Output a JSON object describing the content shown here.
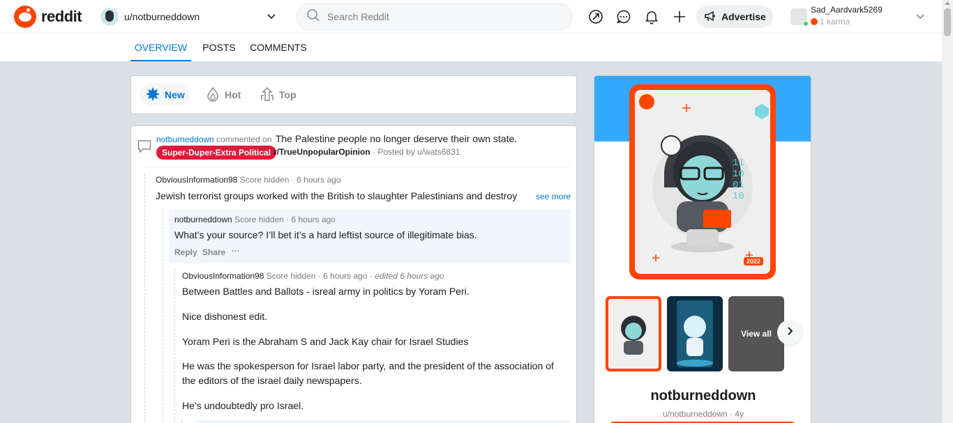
{
  "header": {
    "logo_text": "reddit",
    "context_label": "u/notburneddown",
    "search_placeholder": "Search Reddit",
    "advertise_label": "Advertise",
    "user_name": "Sad_Aardvark5269",
    "user_karma": "1 karma"
  },
  "tabs": [
    {
      "label": "OVERVIEW",
      "active": true
    },
    {
      "label": "POSTS",
      "active": false
    },
    {
      "label": "COMMENTS",
      "active": false
    }
  ],
  "sort": {
    "new_label": "New",
    "hot_label": "Hot",
    "top_label": "Top"
  },
  "post": {
    "author": "notburneddown",
    "action_text": "commented on",
    "title": "The Palestine people no longer deserve their own state.",
    "flair": "Super-Duper-Extra Political",
    "subreddit": "r/TrueUnpopularOpinion",
    "posted_by": "· Posted by u/wats6831"
  },
  "comments": [
    {
      "author": "ObviousInformation98",
      "meta": "Score hidden · 6 hours ago",
      "body": "Jewish terrorist groups worked with the British to slaughter Palestinians and destroy",
      "see_more": "see more"
    },
    {
      "author": "notburneddown",
      "meta": "Score hidden · 6 hours ago",
      "body": "What’s your source? I’ll bet it’s a hard leftist source of illegitimate bias.",
      "reply": "Reply",
      "share": "Share",
      "more": "···"
    },
    {
      "author": "ObviousInformation98",
      "meta": "Score hidden · 6 hours ago ·",
      "edited": "edited 6 hours ago",
      "paragraphs": [
        "Between Battles and Ballots - isreal army in politics by Yoram Peri.",
        "Nice dishonest edit.",
        "Yoram Peri is the Abraham S and Jack Kay chair for Israel Studies",
        "He was the spokesperson for Israel labor party, and the president of the association of the editors of the israel daily newspapers.",
        "He’s undoubtedly pro Israel."
      ]
    }
  ],
  "sidebar": {
    "card_year": "2022",
    "view_all": "View all",
    "profile_name": "notburneddown",
    "profile_sub": "u/notburneddown · 4y"
  },
  "colors": {
    "brand": "#ff4500",
    "link": "#0079d3",
    "flair": "#e01a3c",
    "banner": "#33a8ff"
  }
}
